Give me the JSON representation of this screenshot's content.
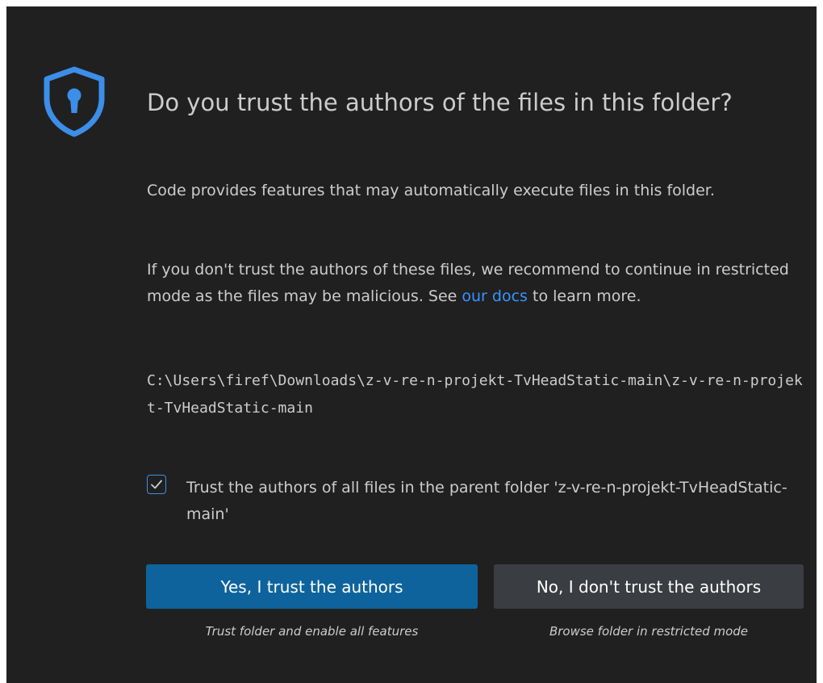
{
  "dialog": {
    "icon": "shield-keyhole-icon",
    "title": "Do you trust the authors of the files in this folder?",
    "paragraph1": "Code provides features that may automatically execute files in this folder.",
    "paragraph2_before": "If you don't trust the authors of these files, we recommend to continue in restricted mode as the files may be malicious. See ",
    "paragraph2_link": "our docs",
    "paragraph2_after": " to learn more.",
    "folder_path": "C:\\Users\\firef\\Downloads\\z-v-re-n-projekt-TvHeadStatic-main\\z-v-re-n-projekt-TvHeadStatic-main",
    "parent_checkbox": {
      "checked": true,
      "label": "Trust the authors of all files in the parent folder 'z-v-re-n-projekt-TvHeadStatic-main'"
    },
    "buttons": {
      "yes_label": "Yes, I trust the authors",
      "yes_caption": "Trust folder and enable all features",
      "no_label": "No, I don't trust the authors",
      "no_caption": "Browse folder in restricted mode"
    }
  },
  "colors": {
    "background": "#202020",
    "text": "#cccccc",
    "accent": "#3794ff",
    "primary_button": "#0e639c",
    "secondary_button": "#3a3d41"
  }
}
